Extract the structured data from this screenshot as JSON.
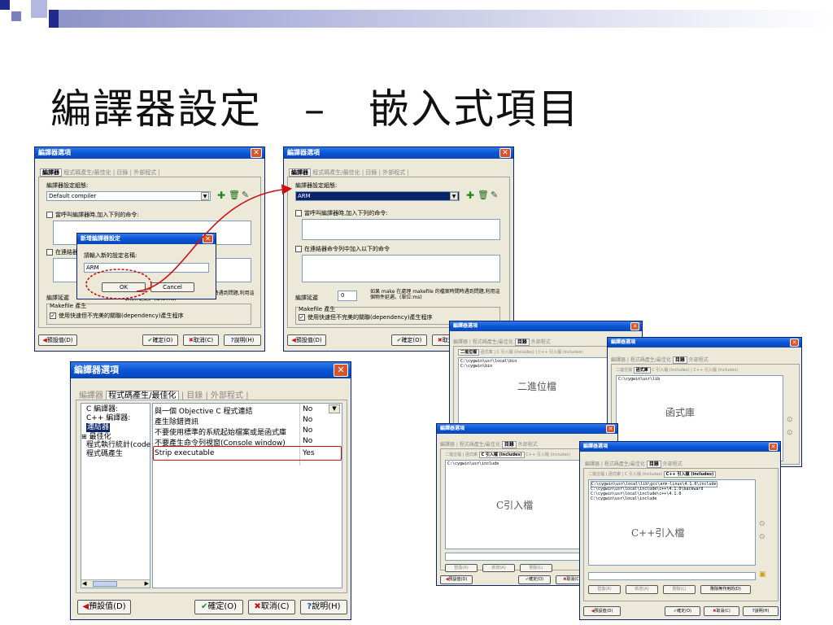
{
  "slide": {
    "title": "編譯器設定　–　嵌入式項目"
  },
  "tabs": {
    "compiler": "編譯器",
    "codegen": "程式碼產生/最佳化",
    "dirs": "目錄",
    "ext": "外部程式"
  },
  "buttons": {
    "default": "預設值(D)",
    "ok": "確定(O)",
    "cancel": "取消(C)",
    "help": "說明(H)",
    "dialog_ok": "OK",
    "dialog_cancel": "Cancel",
    "replace": "替換(R)",
    "add": "新增(A)",
    "delete": "刪除(L)",
    "delete_invalid": "刪除無作用的(D)"
  },
  "win1": {
    "title": "編譯器選項",
    "set_label": "編譯器設定組態:",
    "set_value": "Default compiler",
    "cb_compile": "當呼叫編譯器時,加入下列的命令:",
    "cb_link": "在連結器命令列中加入以下的命令",
    "delay_label": "編譯延遲",
    "delay_note": "如果 make 在處理 makefile 的檔案時間時遇到問題,利用這個物件延遲。(單位:ms)",
    "makefile_group": "Makefile 產生",
    "makefile_cb": "使用快速但不完美的關聯(dependency)產生程序"
  },
  "dialog": {
    "title": "新增編譯器設定",
    "prompt": "請輸入新的設定名稱:",
    "value": "ARM"
  },
  "win2": {
    "title": "編譯器選項",
    "set_label": "編譯器設定組態:",
    "set_value": "ARM",
    "cb_compile": "當呼叫編譯器時,加入下列的命令:",
    "cb_link": "在連結器命令列中加入以下的命令",
    "delay_label": "編譯延遲",
    "delay_value": "0",
    "delay_note": "如果 make 在處理 makefile 的檔案時間時遇到問題,利用這個物件延遲。(單位:ms)",
    "makefile_group": "Makefile 產生",
    "makefile_cb": "使用快速但不完美的關聯(dependency)產生程序"
  },
  "win3": {
    "title": "編譯器選項",
    "tree": [
      "C 編譯器:",
      "C++ 編譯器:",
      "連結器",
      "最佳化",
      "程式執行統計(code",
      "程式碼產生"
    ],
    "rows": [
      {
        "name": "與一個 Objective C 程式連結",
        "value": "No"
      },
      {
        "name": "產生除錯資訊",
        "value": "No"
      },
      {
        "name": "不要使用標準的系統起始檔案或是函式庫",
        "value": "No"
      },
      {
        "name": "不要產生命令列視窗(Console window)",
        "value": "No"
      },
      {
        "name": "Strip executable",
        "value": "Yes"
      }
    ]
  },
  "dirwin": {
    "title": "編譯器選項",
    "subtabs": [
      "二進位檔",
      "函式庫",
      "C 引入檔 (includes)",
      "C++ 引入檔 (includes)"
    ]
  },
  "d1": {
    "paths": [
      "C:\\cygwin\\usr\\local\\bin",
      "C:\\cygwin\\bin"
    ],
    "caption": "二進位檔"
  },
  "d2": {
    "paths": [
      "C:\\cygwin\\usr\\lib"
    ],
    "caption": "函式庫"
  },
  "d3": {
    "paths": [
      "C:\\cygwin\\usr\\include"
    ],
    "caption": "C引入檔"
  },
  "d4": {
    "paths": [
      "C:\\cygwin\\usr\\local\\lib\\gcc\\arm-linux\\4.1.0\\include",
      "C:\\cygwin\\usr\\local\\include\\c++\\4.1.0\\backward",
      "C:\\cygwin\\usr\\local\\include\\c++\\4.1.0",
      "C:\\cygwin\\usr\\local\\include"
    ],
    "caption": "C++引入檔"
  },
  "colors": {
    "titlebar": "#0a55d6",
    "dialog_bg": "#ece9d8",
    "highlight": "#cc1111",
    "accent_bar": "#1f2a8c"
  }
}
